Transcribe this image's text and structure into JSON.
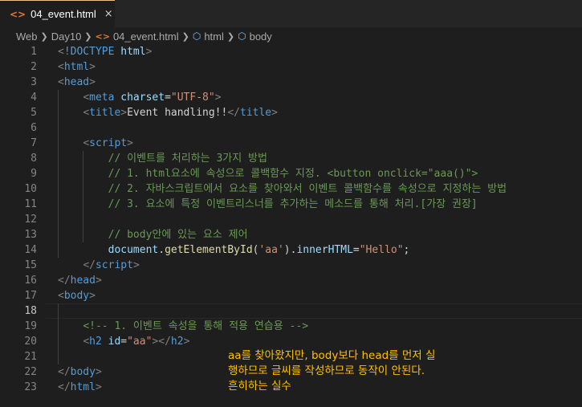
{
  "tab": {
    "icon": "<>",
    "label": "04_event.html",
    "close": "×"
  },
  "breadcrumb": [
    "Web",
    "Day10",
    "04_event.html",
    "html",
    "body"
  ],
  "colors": {
    "background": "#1e1e1e",
    "tag": "#569cd6",
    "attribute": "#9cdcfe",
    "string": "#ce9178",
    "comment": "#6a9955",
    "annotation": "#ffc000"
  },
  "code": {
    "l1_kw": "!DOCTYPE",
    "l1_name": "html",
    "l2_tag": "html",
    "l3_tag": "head",
    "l4_tag": "meta",
    "l4_attr": "charset",
    "l4_val": "\"UTF-8\"",
    "l5_tag": "title",
    "l5_text": "Event handling!!",
    "l7_tag": "script",
    "l8": "// 이벤트를 처리하는 3가지 방법",
    "l9": "// 1. html요소에 속성으로 콜백함수 지정. <button onclick=\"aaa()\">",
    "l10": "// 2. 자바스크립트에서 요소를 찾아와서 이벤트 콜백함수를 속성으로 지정하는 방법",
    "l11": "// 3. 요소에 특정 이벤트리스너를 추가하는 메소드를 통해 처리.[가장 권장]",
    "l13": "// body안에 있는 요소 제어",
    "l14_obj": "document",
    "l14_fn": "getElementById",
    "l14_arg": "'aa'",
    "l14_prop": "innerHTML",
    "l14_val": "\"Hello\"",
    "l16_tag": "head",
    "l17_tag": "body",
    "l19": "<!-- 1. 이벤트 속성을 통해 적용 연습용 -->",
    "l20_tag": "h2",
    "l20_attr": "id",
    "l20_val": "\"aa\"",
    "l22_tag": "body",
    "l23_tag": "html"
  },
  "annotation": [
    "aa를 찾아왔지만, body보다 head를 먼저 실",
    "행하므로 글씨를 작성하므로 동작이 안된다.",
    "흔히하는 실수"
  ]
}
